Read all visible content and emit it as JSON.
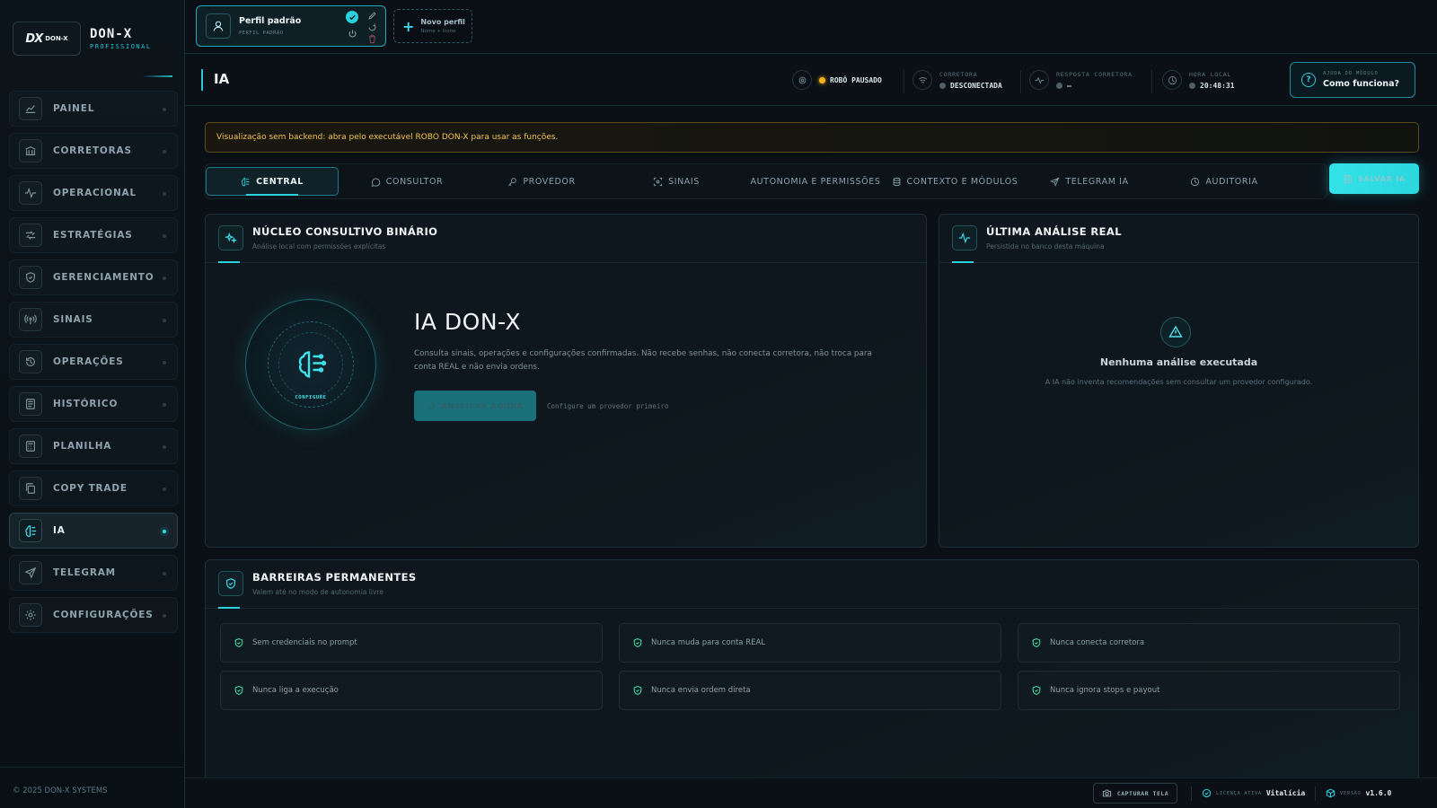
{
  "sidebar": {
    "brand": {
      "logo_text": "DX",
      "logo_small": "DON-X",
      "name": "DON-X",
      "subtitle": "PROFISSIONAL"
    },
    "items": [
      {
        "label": "PAINEL",
        "icon": "chart-line-icon"
      },
      {
        "label": "CORRETORAS",
        "icon": "bank-icon"
      },
      {
        "label": "OPERACIONAL",
        "icon": "activity-icon"
      },
      {
        "label": "ESTRATÉGIAS",
        "icon": "strategy-icon"
      },
      {
        "label": "GERENCIAMENTO",
        "icon": "shield-icon"
      },
      {
        "label": "SINAIS",
        "icon": "antenna-icon"
      },
      {
        "label": "OPERAÇÕES",
        "icon": "history-icon"
      },
      {
        "label": "HISTÓRICO",
        "icon": "document-list-icon"
      },
      {
        "label": "PLANILHA",
        "icon": "calculator-icon"
      },
      {
        "label": "COPY TRADE",
        "icon": "copy-icon"
      },
      {
        "label": "IA",
        "icon": "brain-icon",
        "active": true
      },
      {
        "label": "TELEGRAM",
        "icon": "send-icon"
      },
      {
        "label": "CONFIGURAÇÕES",
        "icon": "gear-icon"
      }
    ],
    "copyright": "© 2025 DON-X SYSTEMS"
  },
  "profile": {
    "name": "Perfil padrão",
    "sub": "PERFIL PADRÃO",
    "new_name": "Novo perfil",
    "new_sub": "Nome + ícone"
  },
  "header": {
    "title": "IA",
    "robot_status": "ROBÔ PAUSADO",
    "broker_label": "CORRETORA",
    "broker_value": "DESCONECTADA",
    "response_label": "RESPOSTA CORRETORA",
    "response_value": "–",
    "time_label": "HORA LOCAL",
    "time_value": "20:48:31",
    "help_label": "AJUDA DO MÓDULO",
    "help_value": "Como funciona?"
  },
  "warning": "Visualização sem backend: abra pelo executável ROBO DON-X para usar as funções.",
  "tabs": [
    {
      "label": "CENTRAL",
      "icon": "brain-icon",
      "active": true
    },
    {
      "label": "CONSULTOR",
      "icon": "chat-icon"
    },
    {
      "label": "PROVEDOR",
      "icon": "key-icon"
    },
    {
      "label": "SINAIS",
      "icon": "scan-icon"
    },
    {
      "label": "AUTONOMIA E PERMISSÕES",
      "icon": ""
    },
    {
      "label": "CONTEXTO E MÓDULOS",
      "icon": "database-icon"
    },
    {
      "label": "TELEGRAM IA",
      "icon": "send-icon"
    },
    {
      "label": "AUDITORIA",
      "icon": "clock-icon"
    }
  ],
  "save_button": "SALVAR IA",
  "core_panel": {
    "title": "NÚCLEO CONSULTIVO BINÁRIO",
    "subtitle": "Análise local com permissões explícitas",
    "core_label": "CONFIGURE",
    "ia_title": "IA DON-X",
    "description": "Consulta sinais, operações e configurações confirmadas. Não recebe senhas, não conecta corretora, não troca para conta REAL e não envia ordens.",
    "analyze_button": "ANALISAR AGORA",
    "hint": "Configure um provedor primeiro"
  },
  "analysis_panel": {
    "title": "ÚLTIMA ANÁLISE REAL",
    "subtitle": "Persistida no banco desta máquina",
    "empty_title": "Nenhuma análise executada",
    "empty_desc": "A IA não inventa recomendações sem consultar um provedor configurado."
  },
  "barriers_panel": {
    "title": "BARREIRAS PERMANENTES",
    "subtitle": "Valem até no modo de autonomia livre",
    "items": [
      "Sem credenciais no prompt",
      "Nunca muda para conta REAL",
      "Nunca conecta corretora",
      "Nunca liga a execução",
      "Nunca envia ordem direta",
      "Nunca ignora stops e payout"
    ]
  },
  "footer": {
    "capture": "CAPTURAR TELA",
    "license_label": "LICENÇA ATIVA",
    "license_value": "Vitalícia",
    "version_label": "VERSÃO",
    "version_value": "v1.6.0"
  },
  "colors": {
    "accent": "#2ad2de",
    "warning": "#f0c24a",
    "status_amber": "#f4b41a"
  }
}
